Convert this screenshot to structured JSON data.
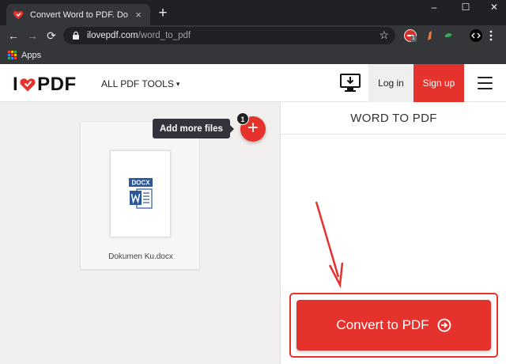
{
  "browser": {
    "tab_title": "Convert Word to PDF. Documents",
    "tab_close": "×",
    "new_tab": "+",
    "window_controls": {
      "minimize": "–",
      "maximize": "☐",
      "close": "✕"
    },
    "nav": {
      "back": "←",
      "forward": "→",
      "reload": "⟳"
    },
    "url_host": "ilovepdf.com",
    "url_path": "/word_to_pdf",
    "star": "☆",
    "extension_badge": "1",
    "bookmarks": {
      "apps_label": "Apps"
    }
  },
  "site": {
    "logo_left": "I",
    "logo_right": "PDF",
    "tools_menu": "ALL PDF TOOLS",
    "tools_caret": "▾",
    "login": "Log in",
    "signup": "Sign up"
  },
  "workspace": {
    "file_name": "Dokumen Ku.docx",
    "file_type_label": "DOCX",
    "add_tooltip": "Add more files",
    "add_symbol": "+",
    "file_count": "1"
  },
  "panel": {
    "title": "WORD TO PDF",
    "convert_label": "Convert to PDF"
  },
  "colors": {
    "brand_red": "#e5322d",
    "word_blue": "#2b579a",
    "chrome_dark": "#202124",
    "chrome_toolbar": "#35363a"
  }
}
